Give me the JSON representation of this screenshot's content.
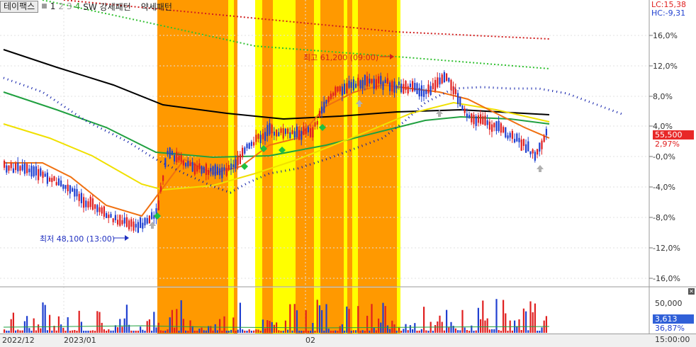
{
  "toolbar": {
    "stock_name": "테이팩스",
    "num1": "1",
    "num2": "2",
    "num3": "3",
    "num4": "4",
    "pattern_strong": "SW 강세패턴",
    "pattern_weak": "약세패턴"
  },
  "header_right": {
    "lc": "LC:15,38",
    "hc": "HC:-9,31"
  },
  "price_axis": {
    "labels": [
      "16,0%",
      "12,0%",
      "8,0%",
      "4,0%",
      "-0,0%",
      "-4,0%",
      "-8,0%",
      "-12,0%",
      "-16,0%"
    ],
    "current_price": "55,500",
    "current_pct": "2,97%"
  },
  "annotations": {
    "high": "최고 61,200 (09:00)",
    "low": "최저 48,100 (13:00)"
  },
  "volume_axis": {
    "label": "50,000",
    "current": "3,613",
    "pct": "36,87%"
  },
  "x_axis": {
    "dates": [
      "2022/12",
      "2023/01",
      "02"
    ],
    "time": "15:00:00"
  },
  "colors": {
    "up": "#e02020",
    "down": "#2040d0",
    "band_strong": "#ff9900",
    "band_weak": "#ffff00",
    "ma_black": "#000000",
    "ma_green": "#20a040",
    "ma_yellow": "#f0e000",
    "ma_orange": "#f07010",
    "ma_dotted_blue": "#0818a8"
  },
  "chart_data": {
    "type": "candlestick",
    "y_axis_unit": "%",
    "y_ticks": [
      16,
      12,
      8,
      4,
      0,
      -4,
      -8,
      -12,
      -16
    ],
    "current_price": 55500,
    "current_change_pct": 2.97,
    "high": {
      "price": 61200,
      "time": "09:00"
    },
    "low": {
      "price": 48100,
      "time": "13:00"
    },
    "volume_tick": 50000,
    "current_volume": 3613,
    "volume_ratio_pct": 36.87
  },
  "icons": {
    "close": "close-icon",
    "arrow_up": "arrow-up-icon",
    "arrow_right": "arrow-right-icon"
  }
}
